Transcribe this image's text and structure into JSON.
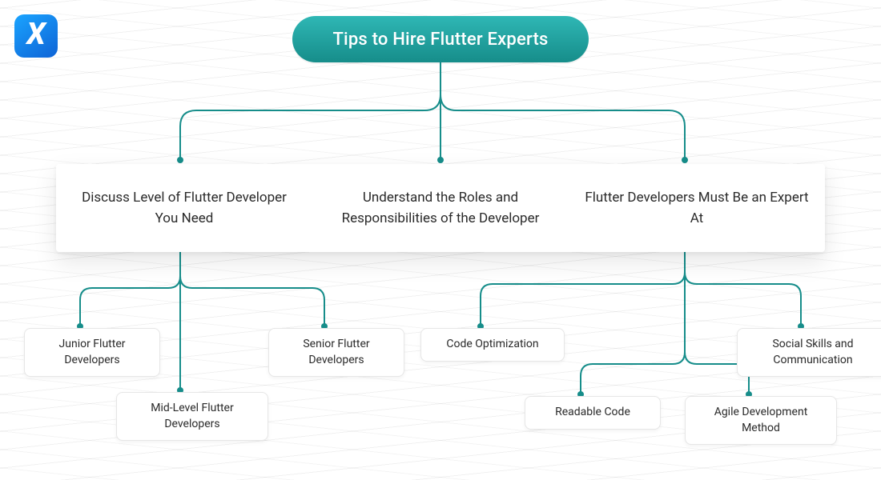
{
  "logo_letter": "X",
  "title": "Tips to Hire Flutter Experts",
  "columns": [
    "Discuss Level of Flutter Developer You Need",
    "Understand the Roles and Responsibilities of the Developer",
    "Flutter Developers Must Be an Expert At"
  ],
  "leaves": {
    "junior": "Junior Flutter Developers",
    "mid": "Mid-Level Flutter Developers",
    "senior": "Senior Flutter Developers",
    "codeopt": "Code Optimization",
    "readable": "Readable Code",
    "agile": "Agile Development Method",
    "social": "Social Skills and Communication"
  },
  "colors": {
    "accent": "#168d8a"
  }
}
